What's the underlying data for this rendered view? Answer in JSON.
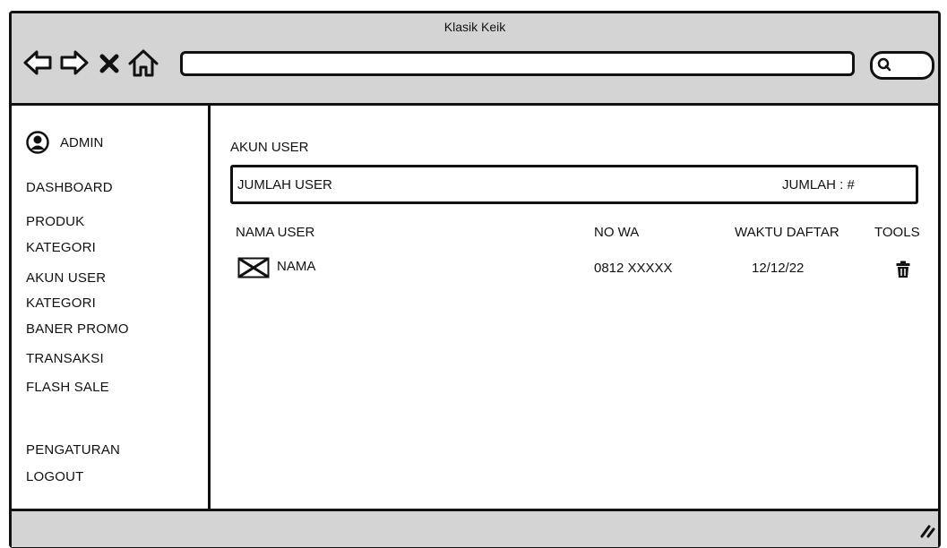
{
  "window": {
    "title": "Klasik Keik"
  },
  "toolbar": {
    "icons": [
      "back-arrow-icon",
      "forward-arrow-icon",
      "close-icon",
      "home-icon",
      "search-icon"
    ],
    "address_value": ""
  },
  "sidebar": {
    "admin_label": "ADMIN",
    "items": [
      "DASHBOARD",
      "PRODUK",
      "KATEGORI",
      "AKUN USER",
      "KATEGORI",
      "BANER PROMO",
      "TRANSAKSI",
      "FLASH SALE",
      "PENGATURAN",
      "LOGOUT"
    ]
  },
  "main": {
    "page_title": "AKUN USER",
    "summary": {
      "label": "JUMLAH USER",
      "count_text": "JUMLAH : #"
    },
    "table": {
      "headers": [
        "NAMA USER",
        "NO WA",
        "WAKTU DAFTAR",
        "TOOLS"
      ],
      "rows": [
        {
          "name": "NAMA",
          "phone": "0812 XXXXX",
          "date": "12/12/22",
          "tool_icon": "trash-icon"
        }
      ]
    }
  },
  "colors": {
    "chrome_gray": "#d4d4d4",
    "stroke": "#111111"
  }
}
